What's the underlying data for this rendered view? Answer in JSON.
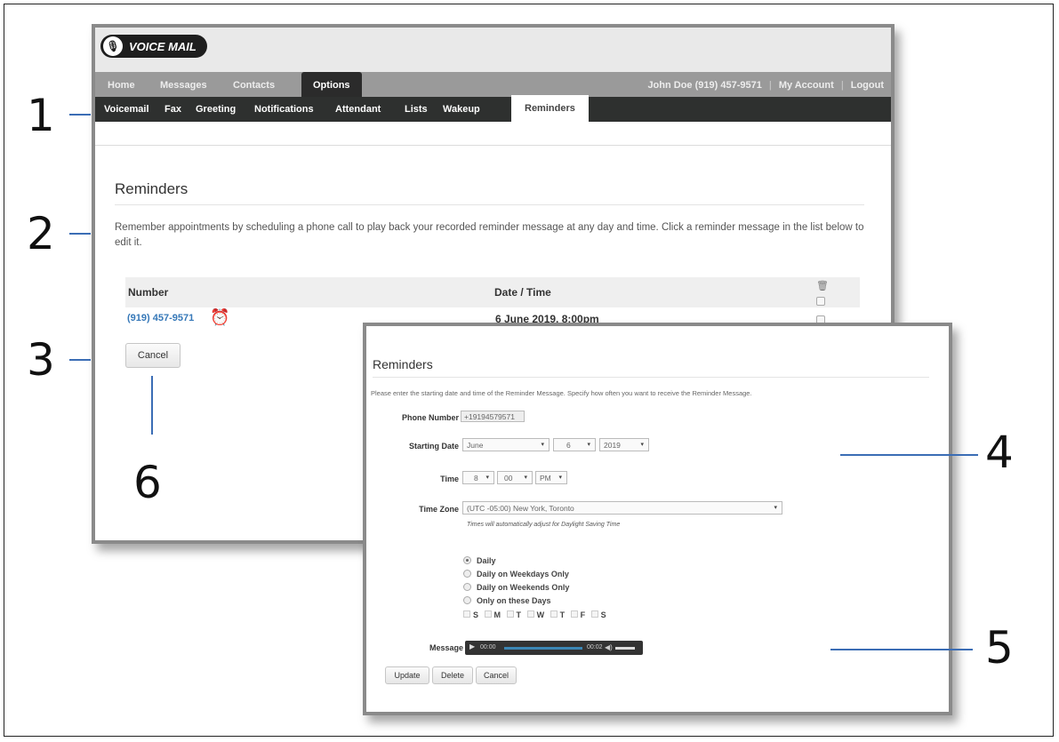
{
  "app": {
    "logo_text": "VOICE MAIL",
    "logo_icon": "microphone-icon",
    "nav": [
      "Home",
      "Messages",
      "Contacts",
      "Options"
    ],
    "nav_active": "Options",
    "user": {
      "name_phone": "John Doe  (919) 457-9571",
      "sep1": "|",
      "my_account": "My Account",
      "sep2": "|",
      "logout": "Logout"
    },
    "subnav": [
      "Voicemail",
      "Fax",
      "Greeting",
      "Notifications",
      "Attendant",
      "Lists",
      "Wakeup",
      "Reminders"
    ],
    "subnav_active": "Reminders"
  },
  "list_view": {
    "title": "Reminders",
    "description": "Remember appointments by scheduling a phone call to play back your recorded reminder message at any day and time. Click a reminder message in the list below to edit it.",
    "columns": [
      "Number",
      "Date / Time"
    ],
    "delete_icon": "trash-icon",
    "rows": [
      {
        "number": "(919) 457-9571",
        "icon": "alarm-clock-icon",
        "datetime": "6 June 2019, 8:00pm"
      }
    ],
    "cancel_label": "Cancel"
  },
  "edit_view": {
    "title": "Reminders",
    "description": "Please enter the starting date and time of the Reminder Message. Specify how often you want to receive the Reminder Message.",
    "phone_label": "Phone Number",
    "phone_value": "+19194579571",
    "date_label": "Starting Date",
    "date_month": "June",
    "date_day": "6",
    "date_year": "2019",
    "time_label": "Time",
    "time_hour": "8",
    "time_minute": "00",
    "time_ampm": "PM",
    "tz_label": "Time Zone",
    "tz_value": "(UTC -05:00) New York, Toronto",
    "tz_hint": "Times will automatically adjust for Daylight Saving Time",
    "frequency": [
      {
        "label": "Daily",
        "selected": true
      },
      {
        "label": "Daily on Weekdays Only",
        "selected": false
      },
      {
        "label": "Daily on Weekends Only",
        "selected": false
      },
      {
        "label": "Only on these Days",
        "selected": false
      }
    ],
    "days": [
      "S",
      "M",
      "T",
      "W",
      "T",
      "F",
      "S"
    ],
    "message_label": "Message",
    "player": {
      "elapsed": "00:00",
      "duration": "00:02",
      "play_icon": "play-icon",
      "volume_icon": "volume-icon"
    },
    "buttons": {
      "update": "Update",
      "delete": "Delete",
      "cancel": "Cancel"
    }
  },
  "callouts": [
    "1",
    "2",
    "3",
    "4",
    "5",
    "6"
  ],
  "colors": {
    "accent_line": "#3b6db5",
    "link": "#3678b8",
    "subnav_bg": "#2e302f",
    "nav_bg": "#9a9a9a"
  }
}
